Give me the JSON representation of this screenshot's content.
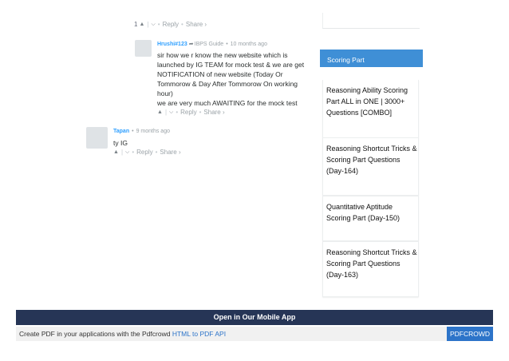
{
  "comments": [
    {
      "vote_count": "1",
      "up_icon": "caret-up",
      "down_icon": "caret-down",
      "reply_label": "Reply",
      "share_label": "Share ›"
    },
    {
      "author": "Hrushi#123",
      "reply_to": "IBPS Guide",
      "time": "10 months ago",
      "lines": [
        "sir how we r know the new website which is",
        "launched by IG TEAM for mock test & we are get",
        "NOTIFICATION of new website (Today Or",
        "Tommorow & Day After Tommorow On working",
        "hour)",
        "we are very much AWAITING for the mock test"
      ],
      "reply_label": "Reply",
      "share_label": "Share ›"
    },
    {
      "author": "Tapan",
      "time": "9 months ago",
      "lines": [
        "ty IG"
      ],
      "reply_label": "Reply",
      "share_label": "Share ›"
    }
  ],
  "sidebar": {
    "header": "Scoring Part",
    "items": [
      {
        "title": "Reasoning Ability Scoring Part ALL in ONE | 3000+ Questions [COMBO]"
      },
      {
        "title": "Reasoning Shortcut Tricks & Scoring Part Questions (Day-164)"
      },
      {
        "title": "Quantitative Aptitude Scoring Part (Day-150)"
      },
      {
        "title": "Reasoning Shortcut Tricks & Scoring Part Questions (Day-163)"
      }
    ]
  },
  "app_banner": "Open in Our Mobile App",
  "pdf_footer": {
    "text": "Create PDF in your applications with the Pdfcrowd",
    "link": "HTML to PDF API",
    "button": "PDFCROWD"
  },
  "colors": {
    "author": "#2e9fff",
    "sidebar_header": "#3f8fd6",
    "app_banner": "#263556",
    "pdf_button": "#2d74c9"
  }
}
